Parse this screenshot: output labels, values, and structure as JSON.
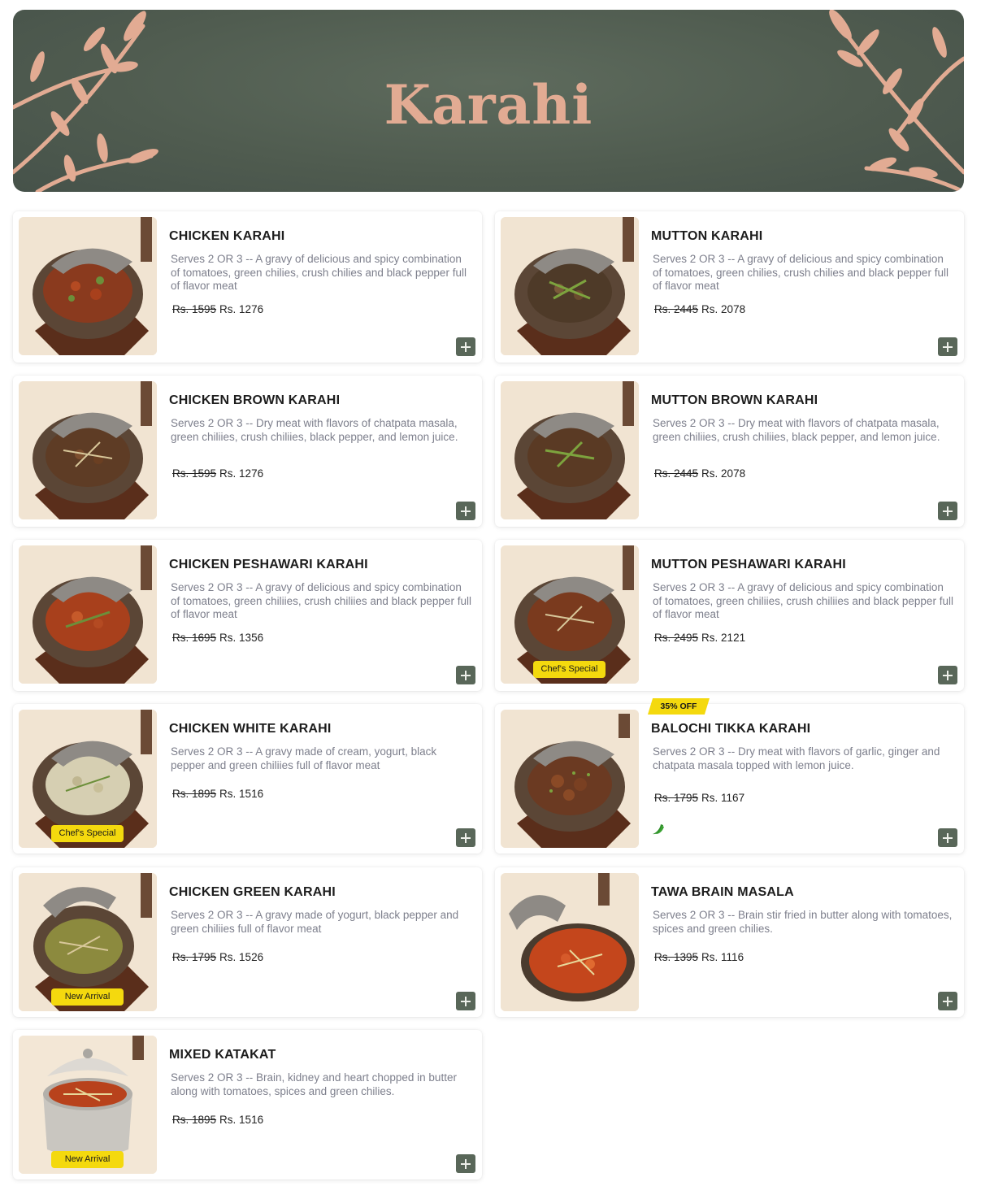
{
  "banner": {
    "title": "Karahi"
  },
  "colors": {
    "banner_bg": "#4f5b4f",
    "leaf": "#e2ab93",
    "tag": "#f4d90e",
    "add_button": "#596759"
  },
  "items": [
    {
      "name": "CHICKEN KARAHI",
      "desc": "Serves 2 OR 3 -- A gravy of delicious and spicy combination of tomatoes, green chilies, crush chilies and black pepper full of flavor meat",
      "old_price": "Rs. 1595",
      "price": "Rs. 1276",
      "tag": "",
      "add_icon": "plus-icon"
    },
    {
      "name": "MUTTON KARAHI",
      "desc": "Serves 2 OR 3 -- A gravy of delicious and spicy combination of tomatoes, green chilies, crush chilies and black pepper full of flavor meat",
      "old_price": "Rs. 2445",
      "price": "Rs. 2078",
      "tag": "",
      "add_icon": "plus-icon"
    },
    {
      "name": "CHICKEN BROWN KARAHI",
      "desc": "Serves 2 OR 3 -- Dry meat with flavors of chatpata masala, green chiliies, crush chiliies, black pepper, and lemon juice.",
      "old_price": "Rs. 1595",
      "price": "Rs. 1276",
      "tag": "",
      "add_icon": "plus-icon"
    },
    {
      "name": "MUTTON BROWN KARAHI",
      "desc": "Serves 2 OR 3 -- Dry meat with flavors of chatpata masala, green chiliies, crush chiliies, black pepper, and lemon juice.",
      "old_price": "Rs. 2445",
      "price": "Rs. 2078",
      "tag": "",
      "add_icon": "plus-icon"
    },
    {
      "name": "CHICKEN PESHAWARI KARAHI",
      "desc": "Serves 2 OR 3 -- A gravy of delicious and spicy combination of tomatoes, green chiliies, crush chiliies and black pepper full of flavor meat",
      "old_price": "Rs. 1695",
      "price": "Rs. 1356",
      "tag": "",
      "add_icon": "plus-icon"
    },
    {
      "name": "MUTTON PESHAWARI KARAHI",
      "desc": "Serves 2 OR 3 -- A gravy of delicious and spicy combination of tomatoes, green chiliies, crush chiliies and black pepper full of flavor meat",
      "old_price": "Rs. 2495",
      "price": "Rs. 2121",
      "tag": "Chef's Special",
      "add_icon": "plus-icon"
    },
    {
      "name": "CHICKEN WHITE KARAHI",
      "desc": "Serves 2 OR 3 -- A gravy made of cream, yogurt, black pepper and green chiliies full of flavor meat",
      "old_price": "Rs. 1895",
      "price": "Rs. 1516",
      "tag": "Chef's Special",
      "add_icon": "plus-icon"
    },
    {
      "name": "BALOCHI TIKKA KARAHI",
      "desc": "Serves 2 OR 3 -- Dry meat with flavors of garlic, ginger and chatpata masala topped with lemon juice.",
      "old_price": "Rs. 1795",
      "price": "Rs. 1167",
      "tag": "",
      "discount": "35% OFF",
      "spicy_icon": "chili-icon",
      "add_icon": "plus-icon"
    },
    {
      "name": "CHICKEN GREEN KARAHI",
      "desc": "Serves 2 OR 3 -- A gravy made of yogurt, black pepper and green chiliies full of flavor meat",
      "old_price": "Rs. 1795",
      "price": "Rs. 1526",
      "tag": "New Arrival",
      "add_icon": "plus-icon"
    },
    {
      "name": "TAWA BRAIN MASALA",
      "desc": "Serves 2 OR 3 -- Brain stir fried in butter along with tomatoes, spices and green chilies.",
      "old_price": "Rs. 1395",
      "price": "Rs. 1116",
      "tag": "",
      "add_icon": "plus-icon"
    },
    {
      "name": "MIXED KATAKAT",
      "desc": "Serves 2 OR 3 -- Brain, kidney and heart chopped in butter along with tomatoes, spices and green chilies.",
      "old_price": "Rs. 1895",
      "price": "Rs. 1516",
      "tag": "New Arrival",
      "add_icon": "plus-icon"
    }
  ]
}
